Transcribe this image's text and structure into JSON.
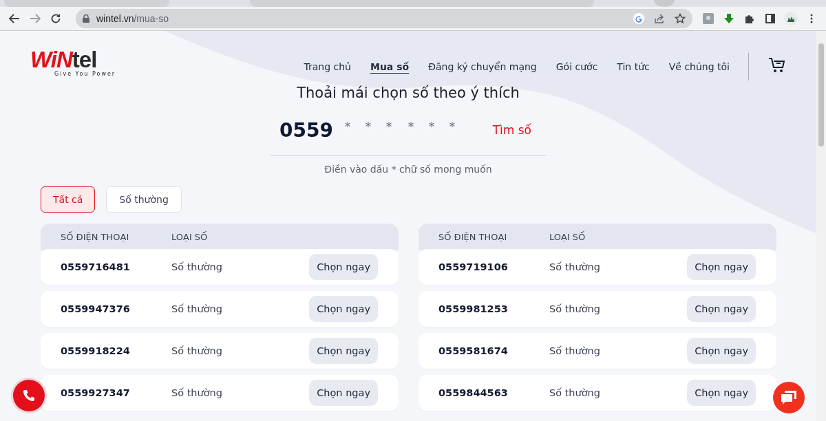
{
  "browser": {
    "url_host": "wintel.vn",
    "url_path": "/mua-so"
  },
  "logo": {
    "brand_red": "WiN",
    "brand_dark": "tel",
    "tagline": "Give You Power"
  },
  "nav": [
    {
      "label": "Trang chủ",
      "selected": false
    },
    {
      "label": "Mua số",
      "selected": true
    },
    {
      "label": "Đăng ký chuyển mạng",
      "selected": false
    },
    {
      "label": "Gói cước",
      "selected": false
    },
    {
      "label": "Tin tức",
      "selected": false
    },
    {
      "label": "Về chúng tôi",
      "selected": false
    }
  ],
  "title": "Thoải mái chọn số theo ý thích",
  "search": {
    "prefix": "0559",
    "masks": [
      [
        "*",
        "*",
        "*"
      ],
      [
        "*",
        "*",
        "*"
      ]
    ],
    "button": "Tìm số",
    "hint": "Điền vào dấu * chữ số mong muốn"
  },
  "filters": [
    {
      "label": "Tất cả",
      "selected": true
    },
    {
      "label": "Số thường",
      "selected": false
    }
  ],
  "tables": [
    {
      "columns": [
        "SỐ ĐIỆN THOẠI",
        "LOẠI SỐ"
      ],
      "rows": [
        {
          "number": "0559716481",
          "type": "Số thường",
          "action": "Chọn ngay"
        },
        {
          "number": "0559947376",
          "type": "Số thường",
          "action": "Chọn ngay"
        },
        {
          "number": "0559918224",
          "type": "Số thường",
          "action": "Chọn ngay"
        },
        {
          "number": "0559927347",
          "type": "Số thường",
          "action": "Chọn ngay"
        }
      ]
    },
    {
      "columns": [
        "SỐ ĐIỆN THOẠI",
        "LOẠI SỐ"
      ],
      "rows": [
        {
          "number": "0559719106",
          "type": "Số thường",
          "action": "Chọn ngay"
        },
        {
          "number": "0559981253",
          "type": "Số thường",
          "action": "Chọn ngay"
        },
        {
          "number": "0559581674",
          "type": "Số thường",
          "action": "Chọn ngay"
        },
        {
          "number": "0559844563",
          "type": "Số thường",
          "action": "Chọn ngay"
        }
      ]
    }
  ]
}
